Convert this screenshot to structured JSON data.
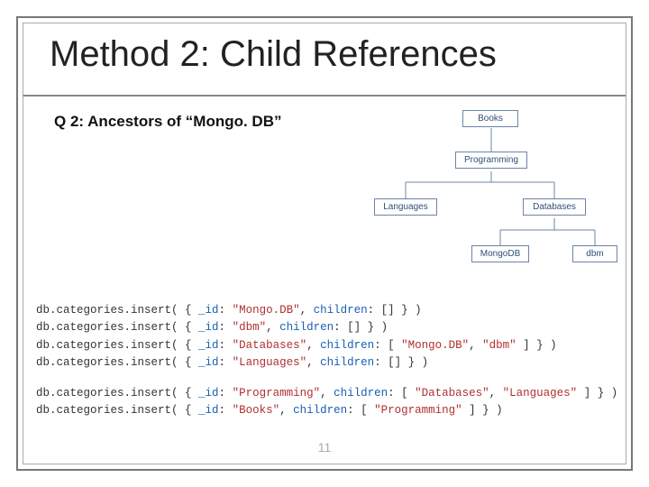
{
  "title": "Method 2: Child References",
  "subtitle": "Q 2: Ancestors of “Mongo. DB”",
  "page_number": "11",
  "tree": {
    "nodes": {
      "books": {
        "label": "Books"
      },
      "programming": {
        "label": "Programming"
      },
      "languages": {
        "label": "Languages"
      },
      "databases": {
        "label": "Databases"
      },
      "mongodb": {
        "label": "MongoDB"
      },
      "dbm": {
        "label": "dbm"
      }
    },
    "edges": [
      [
        "books",
        "programming"
      ],
      [
        "programming",
        "languages"
      ],
      [
        "programming",
        "databases"
      ],
      [
        "databases",
        "mongodb"
      ],
      [
        "databases",
        "dbm"
      ]
    ]
  },
  "code": {
    "inserts": [
      {
        "id": "Mongo.DB",
        "children": []
      },
      {
        "id": "dbm",
        "children": []
      },
      {
        "id": "Databases",
        "children": [
          "Mongo.DB",
          "dbm"
        ]
      },
      {
        "id": "Languages",
        "children": []
      },
      {
        "id": "Programming",
        "children": [
          "Databases",
          "Languages"
        ]
      },
      {
        "id": "Books",
        "children": [
          "Programming"
        ]
      }
    ],
    "break_after_index": 3
  }
}
